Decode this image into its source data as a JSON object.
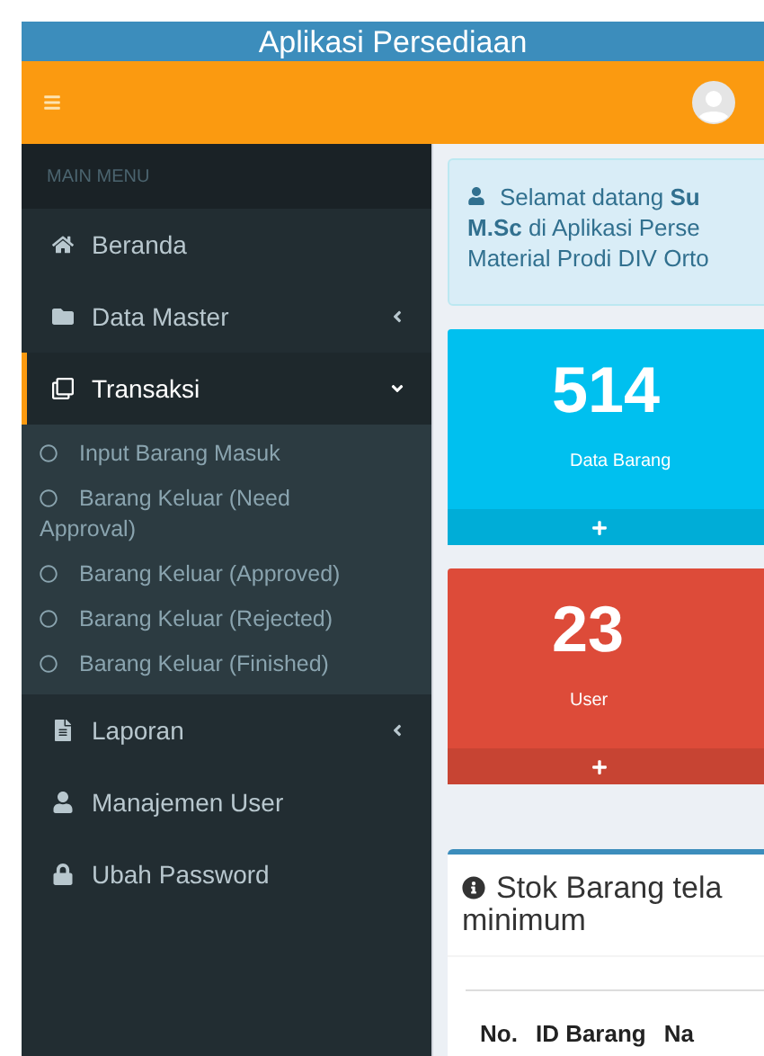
{
  "header": {
    "title": "Aplikasi Persediaan"
  },
  "sidebar": {
    "heading": "MAIN MENU",
    "items": [
      {
        "label": "Beranda",
        "selected": false
      },
      {
        "label": "Data Master",
        "selected": false,
        "expanded": false
      },
      {
        "label": "Transaksi",
        "selected": true,
        "expanded": true,
        "children": [
          {
            "label": "Input Barang Masuk"
          },
          {
            "label": "Barang Keluar (Need Approval)"
          },
          {
            "label": "Barang Keluar (Approved)"
          },
          {
            "label": "Barang Keluar (Rejected)"
          },
          {
            "label": "Barang Keluar (Finished)"
          }
        ]
      },
      {
        "label": "Laporan",
        "selected": false,
        "expanded": false
      },
      {
        "label": "Manajemen User",
        "selected": false
      },
      {
        "label": "Ubah Password",
        "selected": false
      }
    ]
  },
  "welcome": {
    "lines": [
      "Selamat datang **Su**",
      "**M.Sc** di Aplikasi Perse",
      "Material Prodi DIV Orto"
    ]
  },
  "stat_boxes": [
    {
      "value": "514",
      "label": "Data Barang",
      "color": "#00c0ef"
    },
    {
      "value": "23",
      "label": "User",
      "color": "#dd4b39"
    }
  ],
  "stock_panel": {
    "title": "Stok Barang tela",
    "title_line_2": "minimum",
    "columns": [
      "No.",
      "ID Barang",
      "Na"
    ]
  }
}
